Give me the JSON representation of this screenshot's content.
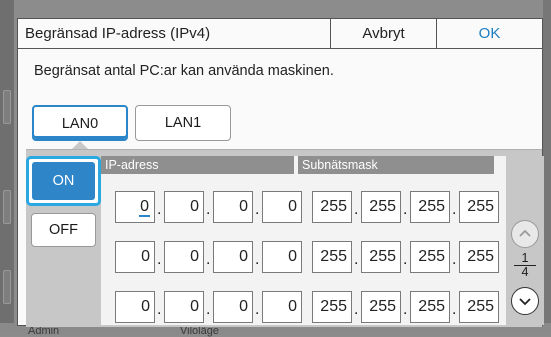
{
  "dialog": {
    "title": "Begränsad IP-adress (IPv4)",
    "cancel_label": "Avbryt",
    "ok_label": "OK",
    "message": "Begränsat antal PC:ar kan använda maskinen."
  },
  "tabs": [
    {
      "label": "LAN0",
      "selected": true
    },
    {
      "label": "LAN1",
      "selected": false
    }
  ],
  "toggle": {
    "on_label": "ON",
    "off_label": "OFF",
    "selected": "ON"
  },
  "columns": {
    "ip": "IP-adress",
    "mask": "Subnätsmask"
  },
  "rows": [
    {
      "ip": [
        "0",
        "0",
        "0",
        "0"
      ],
      "mask": [
        "255",
        "255",
        "255",
        "255"
      ]
    },
    {
      "ip": [
        "0",
        "0",
        "0",
        "0"
      ],
      "mask": [
        "255",
        "255",
        "255",
        "255"
      ]
    },
    {
      "ip": [
        "0",
        "0",
        "0",
        "0"
      ],
      "mask": [
        "255",
        "255",
        "255",
        "255"
      ]
    }
  ],
  "pagination": {
    "current": "1",
    "total": "4"
  },
  "background": {
    "bottom_left": "Admin",
    "bottom_mid": "Viloläge"
  },
  "colors": {
    "accent": "#2e86c9",
    "focus": "#2aa8e2",
    "ok_text": "#1a7ec0"
  },
  "icons": {
    "scroll_up": "chevron-up-icon",
    "scroll_down": "chevron-down-icon"
  }
}
